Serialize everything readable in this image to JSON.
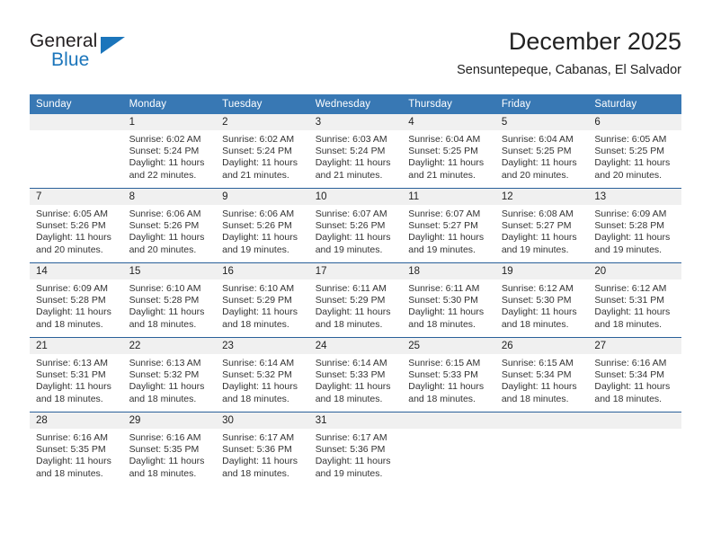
{
  "brand": {
    "name_part1": "General",
    "name_part2": "Blue",
    "triangle_color": "#1b75bb"
  },
  "header": {
    "title": "December 2025",
    "subtitle": "Sensuntepeque, Cabanas, El Salvador"
  },
  "theme": {
    "header_bg": "#3878b4",
    "row_border": "#2a6099",
    "daynum_bg": "#f0f0f0"
  },
  "weekday_headers": [
    "Sunday",
    "Monday",
    "Tuesday",
    "Wednesday",
    "Thursday",
    "Friday",
    "Saturday"
  ],
  "weeks": [
    [
      {
        "day": "",
        "sunrise": "",
        "sunset": "",
        "daylight_line1": "",
        "daylight_line2": ""
      },
      {
        "day": "1",
        "sunrise": "Sunrise: 6:02 AM",
        "sunset": "Sunset: 5:24 PM",
        "daylight_line1": "Daylight: 11 hours",
        "daylight_line2": "and 22 minutes."
      },
      {
        "day": "2",
        "sunrise": "Sunrise: 6:02 AM",
        "sunset": "Sunset: 5:24 PM",
        "daylight_line1": "Daylight: 11 hours",
        "daylight_line2": "and 21 minutes."
      },
      {
        "day": "3",
        "sunrise": "Sunrise: 6:03 AM",
        "sunset": "Sunset: 5:24 PM",
        "daylight_line1": "Daylight: 11 hours",
        "daylight_line2": "and 21 minutes."
      },
      {
        "day": "4",
        "sunrise": "Sunrise: 6:04 AM",
        "sunset": "Sunset: 5:25 PM",
        "daylight_line1": "Daylight: 11 hours",
        "daylight_line2": "and 21 minutes."
      },
      {
        "day": "5",
        "sunrise": "Sunrise: 6:04 AM",
        "sunset": "Sunset: 5:25 PM",
        "daylight_line1": "Daylight: 11 hours",
        "daylight_line2": "and 20 minutes."
      },
      {
        "day": "6",
        "sunrise": "Sunrise: 6:05 AM",
        "sunset": "Sunset: 5:25 PM",
        "daylight_line1": "Daylight: 11 hours",
        "daylight_line2": "and 20 minutes."
      }
    ],
    [
      {
        "day": "7",
        "sunrise": "Sunrise: 6:05 AM",
        "sunset": "Sunset: 5:26 PM",
        "daylight_line1": "Daylight: 11 hours",
        "daylight_line2": "and 20 minutes."
      },
      {
        "day": "8",
        "sunrise": "Sunrise: 6:06 AM",
        "sunset": "Sunset: 5:26 PM",
        "daylight_line1": "Daylight: 11 hours",
        "daylight_line2": "and 20 minutes."
      },
      {
        "day": "9",
        "sunrise": "Sunrise: 6:06 AM",
        "sunset": "Sunset: 5:26 PM",
        "daylight_line1": "Daylight: 11 hours",
        "daylight_line2": "and 19 minutes."
      },
      {
        "day": "10",
        "sunrise": "Sunrise: 6:07 AM",
        "sunset": "Sunset: 5:26 PM",
        "daylight_line1": "Daylight: 11 hours",
        "daylight_line2": "and 19 minutes."
      },
      {
        "day": "11",
        "sunrise": "Sunrise: 6:07 AM",
        "sunset": "Sunset: 5:27 PM",
        "daylight_line1": "Daylight: 11 hours",
        "daylight_line2": "and 19 minutes."
      },
      {
        "day": "12",
        "sunrise": "Sunrise: 6:08 AM",
        "sunset": "Sunset: 5:27 PM",
        "daylight_line1": "Daylight: 11 hours",
        "daylight_line2": "and 19 minutes."
      },
      {
        "day": "13",
        "sunrise": "Sunrise: 6:09 AM",
        "sunset": "Sunset: 5:28 PM",
        "daylight_line1": "Daylight: 11 hours",
        "daylight_line2": "and 19 minutes."
      }
    ],
    [
      {
        "day": "14",
        "sunrise": "Sunrise: 6:09 AM",
        "sunset": "Sunset: 5:28 PM",
        "daylight_line1": "Daylight: 11 hours",
        "daylight_line2": "and 18 minutes."
      },
      {
        "day": "15",
        "sunrise": "Sunrise: 6:10 AM",
        "sunset": "Sunset: 5:28 PM",
        "daylight_line1": "Daylight: 11 hours",
        "daylight_line2": "and 18 minutes."
      },
      {
        "day": "16",
        "sunrise": "Sunrise: 6:10 AM",
        "sunset": "Sunset: 5:29 PM",
        "daylight_line1": "Daylight: 11 hours",
        "daylight_line2": "and 18 minutes."
      },
      {
        "day": "17",
        "sunrise": "Sunrise: 6:11 AM",
        "sunset": "Sunset: 5:29 PM",
        "daylight_line1": "Daylight: 11 hours",
        "daylight_line2": "and 18 minutes."
      },
      {
        "day": "18",
        "sunrise": "Sunrise: 6:11 AM",
        "sunset": "Sunset: 5:30 PM",
        "daylight_line1": "Daylight: 11 hours",
        "daylight_line2": "and 18 minutes."
      },
      {
        "day": "19",
        "sunrise": "Sunrise: 6:12 AM",
        "sunset": "Sunset: 5:30 PM",
        "daylight_line1": "Daylight: 11 hours",
        "daylight_line2": "and 18 minutes."
      },
      {
        "day": "20",
        "sunrise": "Sunrise: 6:12 AM",
        "sunset": "Sunset: 5:31 PM",
        "daylight_line1": "Daylight: 11 hours",
        "daylight_line2": "and 18 minutes."
      }
    ],
    [
      {
        "day": "21",
        "sunrise": "Sunrise: 6:13 AM",
        "sunset": "Sunset: 5:31 PM",
        "daylight_line1": "Daylight: 11 hours",
        "daylight_line2": "and 18 minutes."
      },
      {
        "day": "22",
        "sunrise": "Sunrise: 6:13 AM",
        "sunset": "Sunset: 5:32 PM",
        "daylight_line1": "Daylight: 11 hours",
        "daylight_line2": "and 18 minutes."
      },
      {
        "day": "23",
        "sunrise": "Sunrise: 6:14 AM",
        "sunset": "Sunset: 5:32 PM",
        "daylight_line1": "Daylight: 11 hours",
        "daylight_line2": "and 18 minutes."
      },
      {
        "day": "24",
        "sunrise": "Sunrise: 6:14 AM",
        "sunset": "Sunset: 5:33 PM",
        "daylight_line1": "Daylight: 11 hours",
        "daylight_line2": "and 18 minutes."
      },
      {
        "day": "25",
        "sunrise": "Sunrise: 6:15 AM",
        "sunset": "Sunset: 5:33 PM",
        "daylight_line1": "Daylight: 11 hours",
        "daylight_line2": "and 18 minutes."
      },
      {
        "day": "26",
        "sunrise": "Sunrise: 6:15 AM",
        "sunset": "Sunset: 5:34 PM",
        "daylight_line1": "Daylight: 11 hours",
        "daylight_line2": "and 18 minutes."
      },
      {
        "day": "27",
        "sunrise": "Sunrise: 6:16 AM",
        "sunset": "Sunset: 5:34 PM",
        "daylight_line1": "Daylight: 11 hours",
        "daylight_line2": "and 18 minutes."
      }
    ],
    [
      {
        "day": "28",
        "sunrise": "Sunrise: 6:16 AM",
        "sunset": "Sunset: 5:35 PM",
        "daylight_line1": "Daylight: 11 hours",
        "daylight_line2": "and 18 minutes."
      },
      {
        "day": "29",
        "sunrise": "Sunrise: 6:16 AM",
        "sunset": "Sunset: 5:35 PM",
        "daylight_line1": "Daylight: 11 hours",
        "daylight_line2": "and 18 minutes."
      },
      {
        "day": "30",
        "sunrise": "Sunrise: 6:17 AM",
        "sunset": "Sunset: 5:36 PM",
        "daylight_line1": "Daylight: 11 hours",
        "daylight_line2": "and 18 minutes."
      },
      {
        "day": "31",
        "sunrise": "Sunrise: 6:17 AM",
        "sunset": "Sunset: 5:36 PM",
        "daylight_line1": "Daylight: 11 hours",
        "daylight_line2": "and 19 minutes."
      },
      {
        "day": "",
        "sunrise": "",
        "sunset": "",
        "daylight_line1": "",
        "daylight_line2": ""
      },
      {
        "day": "",
        "sunrise": "",
        "sunset": "",
        "daylight_line1": "",
        "daylight_line2": ""
      },
      {
        "day": "",
        "sunrise": "",
        "sunset": "",
        "daylight_line1": "",
        "daylight_line2": ""
      }
    ]
  ]
}
